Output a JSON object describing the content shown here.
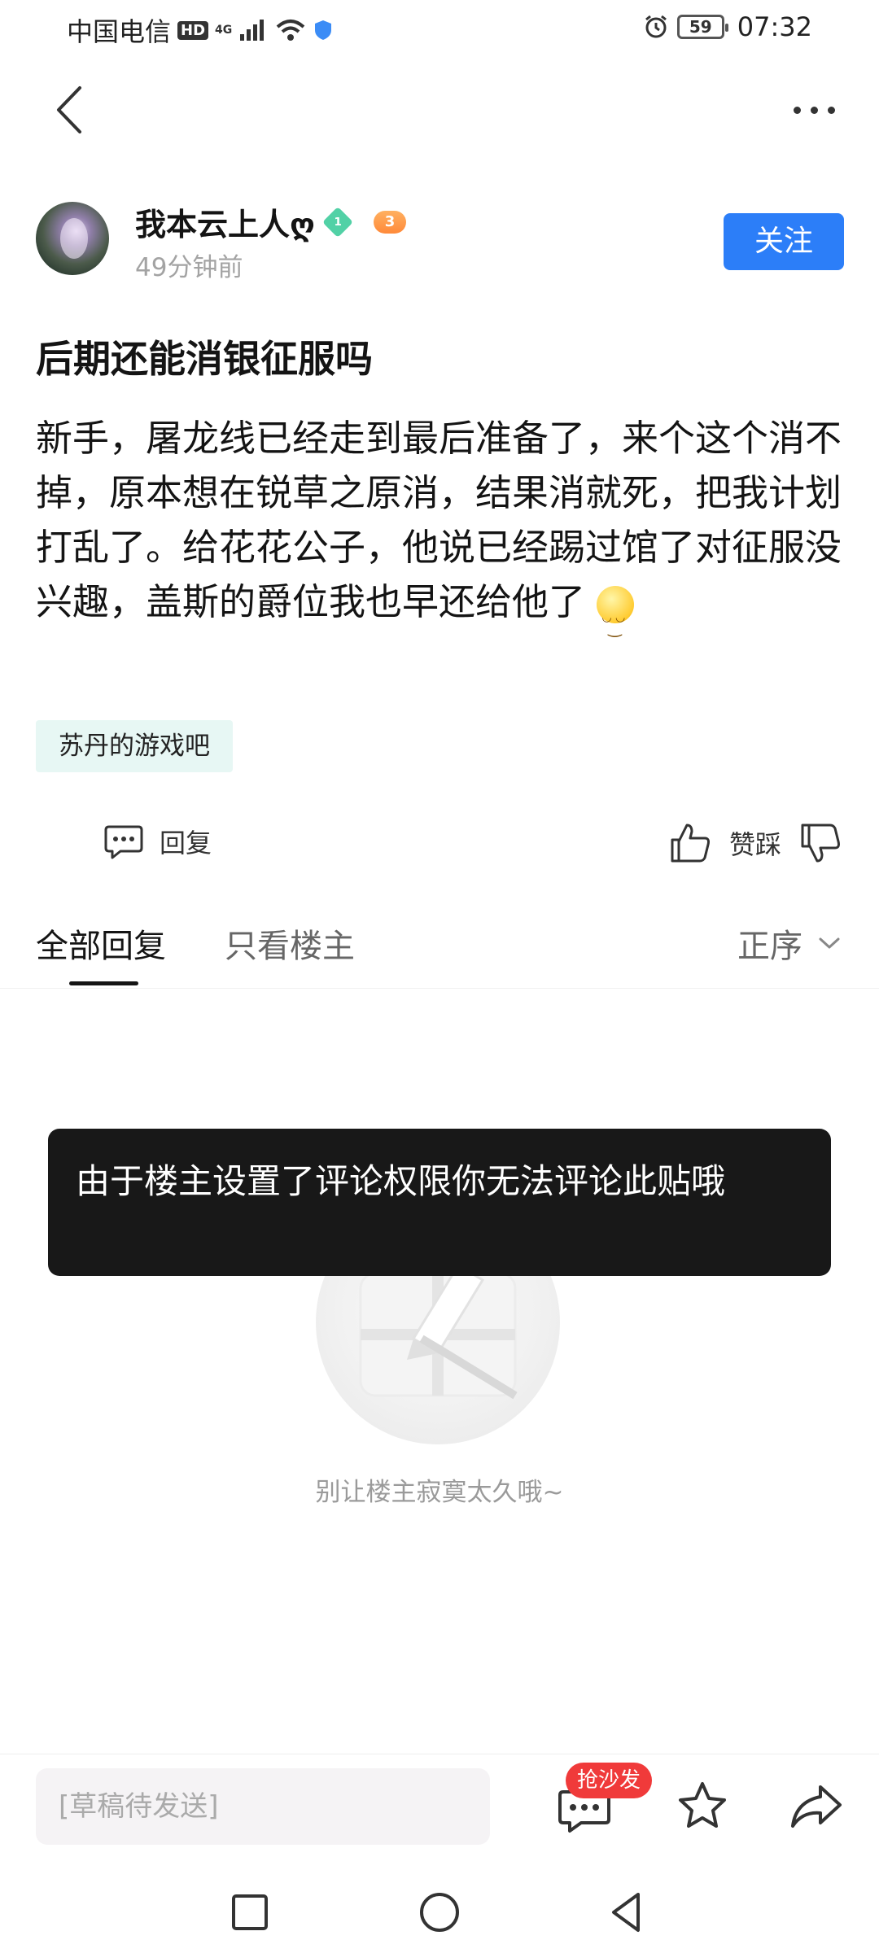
{
  "status_bar": {
    "carrier": "中国电信",
    "hd": "HD",
    "network": "4G",
    "battery": "59",
    "time": "07:32"
  },
  "post": {
    "author_name": "我本云上人ღ",
    "level_badge": "1",
    "game_badge": "3",
    "time_ago": "49分钟前",
    "follow_label": "关注",
    "title": "后期还能消银征服吗",
    "body": "新手，屠龙线已经走到最后准备了，来个这个消不掉，原本想在锐草之原消，结果消就死，把我计划打乱了。给花花公子，他说已经踢过馆了对征服没兴趣，盖斯的爵位我也早还给他了",
    "forum_tag": "苏丹的游戏吧"
  },
  "actions": {
    "reply_label": "回复",
    "vote_label": "赞踩"
  },
  "tabs": {
    "all_replies": "全部回复",
    "owner_only": "只看楼主",
    "sort": "正序"
  },
  "toast": {
    "message": "由于楼主设置了评论权限你无法评论此贴哦"
  },
  "empty_state": {
    "text": "别让楼主寂寞太久哦~"
  },
  "bottom_bar": {
    "draft_placeholder": "[草稿待发送]",
    "sofa_badge": "抢沙发"
  },
  "colors": {
    "accent": "#2c7ef8",
    "tag_bg": "#e7f7f4",
    "badge_red": "#f03a3a",
    "toast_bg": "#181818"
  }
}
